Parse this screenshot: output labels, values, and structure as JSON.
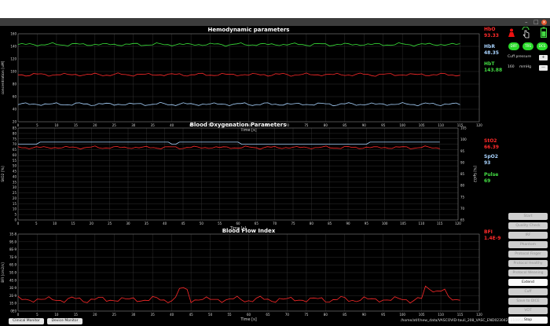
{
  "window": {
    "minimize": "–",
    "maximize": "□",
    "close": "×"
  },
  "panels": [
    {
      "id": "hemo",
      "title": "Hemodynamic parameters",
      "ylabel": "concentration [uM]",
      "xlabel": "Time [s]",
      "ylim": [
        20,
        160
      ],
      "yticks": [
        "20",
        "40",
        "60",
        "80",
        "100",
        "120",
        "140",
        "160"
      ],
      "xlim": [
        0,
        120
      ],
      "xticks": [
        "0",
        "5",
        "10",
        "15",
        "20",
        "25",
        "30",
        "35",
        "40",
        "45",
        "50",
        "55",
        "60",
        "65",
        "70",
        "75",
        "80",
        "85",
        "90",
        "95",
        "100",
        "105",
        "110",
        "115",
        "120"
      ],
      "series": [
        {
          "name": "HbT",
          "color": "#39e339",
          "base": 143
        },
        {
          "name": "HbO",
          "color": "#ff2a2a",
          "base": 95
        },
        {
          "name": "HbR",
          "color": "#a9d4ff",
          "base": 48
        }
      ]
    },
    {
      "id": "oxy",
      "title": "Blood Oxygenation Parameters",
      "ylabel": "StO2 [%]",
      "y2label": "[%] SpO2",
      "xlabel": "Time [s]",
      "ylim": [
        0,
        85
      ],
      "yticks": [
        "0",
        "5",
        "10",
        "15",
        "20",
        "25",
        "30",
        "35",
        "40",
        "45",
        "50",
        "55",
        "60",
        "65",
        "70",
        "75",
        "80",
        "85"
      ],
      "y2ticks": [
        "65",
        "70",
        "75",
        "80",
        "85",
        "90",
        "95",
        "100",
        "105"
      ],
      "xlim": [
        0,
        120
      ],
      "xticks": [
        "0",
        "5",
        "10",
        "15",
        "20",
        "25",
        "30",
        "35",
        "40",
        "45",
        "50",
        "55",
        "60",
        "65",
        "70",
        "75",
        "80",
        "85",
        "90",
        "95",
        "100",
        "105",
        "110",
        "115",
        "120"
      ],
      "series": [
        {
          "name": "SpO2",
          "color": "#a9d4ff",
          "base": 70
        },
        {
          "name": "StO2",
          "color": "#ff2a2a",
          "base": 67
        }
      ]
    },
    {
      "id": "bfi",
      "title": "Blood Flow Index",
      "ylabel": "BFI [cm2/s]",
      "xlabel": "Time [s]",
      "ylim": [
        0,
        10
      ],
      "yticks": [
        "0E0",
        "1E-9",
        "2E-9",
        "3E-9",
        "4E-9",
        "5E-9",
        "6E-9",
        "7E-9",
        "8E-9",
        "9E-9",
        "1E-8"
      ],
      "xlim": [
        0,
        120
      ],
      "xticks": [
        "0",
        "5",
        "10",
        "15",
        "20",
        "25",
        "30",
        "35",
        "40",
        "45",
        "50",
        "55",
        "60",
        "65",
        "70",
        "75",
        "80",
        "85",
        "90",
        "95",
        "100",
        "105",
        "110",
        "115",
        "120"
      ],
      "series": [
        {
          "name": "BFI",
          "color": "#ff2a2a",
          "base": 1.5
        }
      ]
    }
  ],
  "readouts": {
    "hbo": {
      "label": "HbO",
      "value": "93.33"
    },
    "hbr": {
      "label": "HbR",
      "value": "48.35"
    },
    "hbt": {
      "label": "HbT",
      "value": "143.88"
    },
    "sto2": {
      "label": "StO2",
      "value": "66.39"
    },
    "spo2": {
      "label": "SpO2",
      "value": "93"
    },
    "pulse": {
      "label": "Pulse",
      "value": "69"
    },
    "bfi": {
      "label": "BFI",
      "value": "1.4E-9"
    }
  },
  "status": {
    "pills": [
      "DIFF",
      "TRS",
      "DCS"
    ],
    "cuff_label": "Cuff pressure",
    "cuff_value": "160",
    "cuff_unit": "mmHg",
    "plus": "+",
    "minus": "—"
  },
  "right_buttons": [
    {
      "label": "Start",
      "enabled": false
    },
    {
      "label": "Quality Check",
      "enabled": false
    },
    {
      "label": "IRF",
      "enabled": false
    },
    {
      "label": "Phantom",
      "enabled": false
    },
    {
      "label": "Protocol Finger",
      "enabled": false
    },
    {
      "label": "Protocol Healthy",
      "enabled": false
    },
    {
      "label": "Protocol Weaning",
      "enabled": false
    },
    {
      "label": "Extend",
      "enabled": true
    },
    {
      "label": "Cuff",
      "enabled": false
    },
    {
      "label": "Save to DICE",
      "enabled": false
    },
    {
      "label": "VOT",
      "enabled": false
    },
    {
      "label": "Stop",
      "enabled": true
    }
  ],
  "bottom": {
    "clinical": "Clinical Monitor",
    "device": "Device Monitor",
    "path": "/home/atif/new_data/VASCOVID-tauli_208_VASC_END0230421110956"
  }
}
